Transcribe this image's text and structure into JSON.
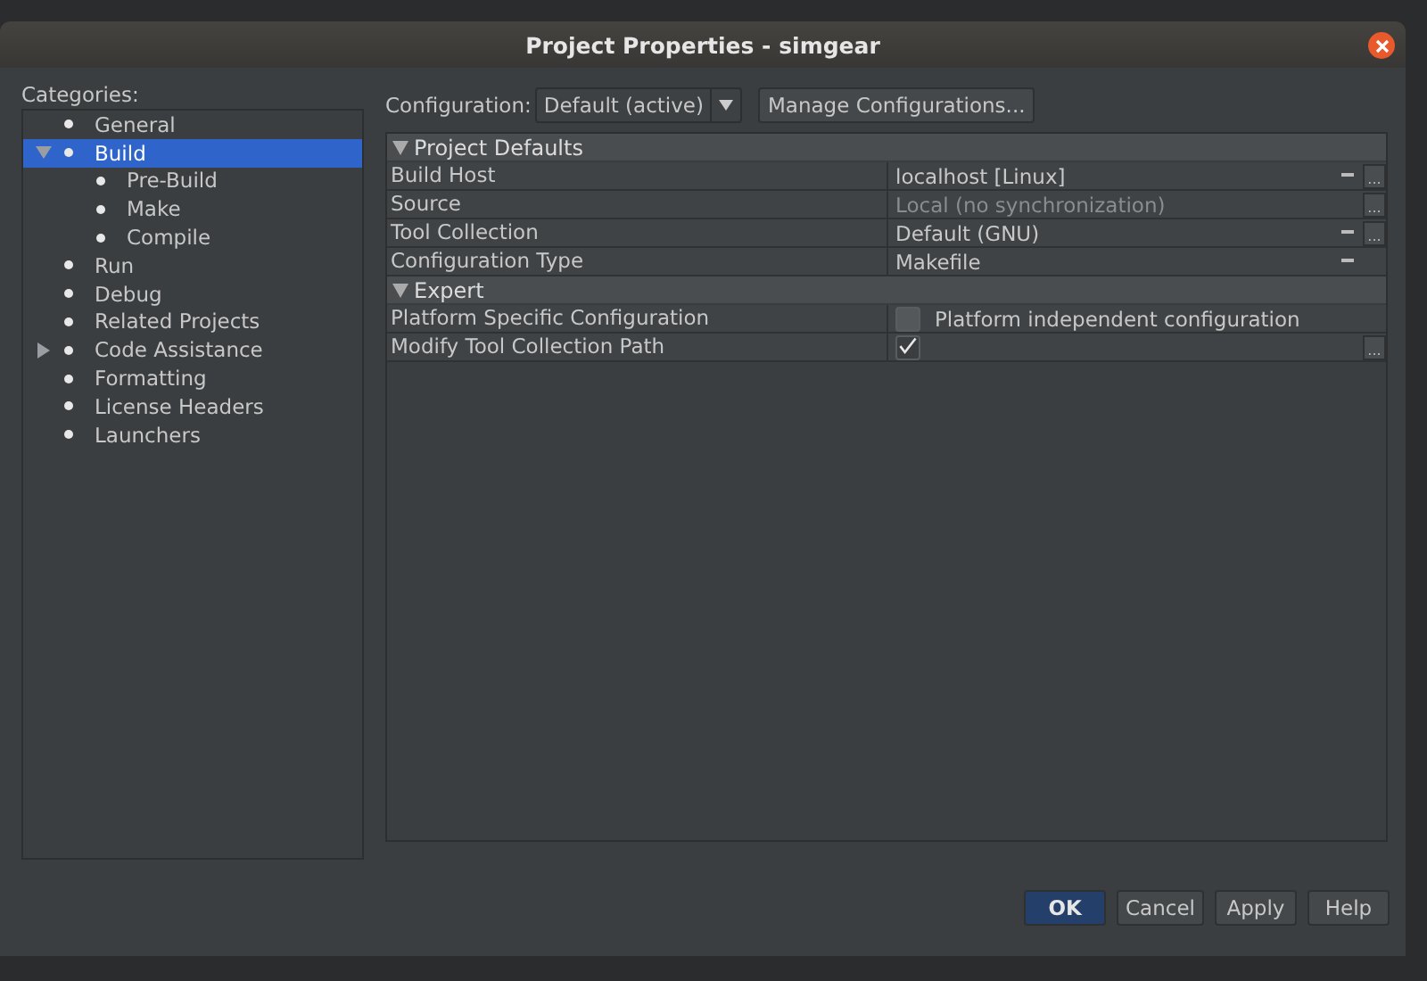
{
  "window": {
    "title": "Project Properties - simgear"
  },
  "categories": {
    "label": "Categories:",
    "items": [
      {
        "label": "General",
        "selected": false
      },
      {
        "label": "Build",
        "selected": true,
        "expanded": true,
        "children": [
          {
            "label": "Pre-Build",
            "selected": false
          },
          {
            "label": "Make",
            "selected": false
          },
          {
            "label": "Compile",
            "selected": false
          }
        ]
      },
      {
        "label": "Run",
        "selected": false
      },
      {
        "label": "Debug",
        "selected": false
      },
      {
        "label": "Related Projects",
        "selected": false
      },
      {
        "label": "Code Assistance",
        "selected": false,
        "expanded": false
      },
      {
        "label": "Formatting",
        "selected": false
      },
      {
        "label": "License Headers",
        "selected": false
      },
      {
        "label": "Launchers",
        "selected": false
      }
    ]
  },
  "configuration": {
    "label": "Configuration:",
    "value": "Default (active)",
    "manage_button": "Manage Configurations..."
  },
  "property_sheet": [
    {
      "title": "Project Defaults",
      "expanded": true,
      "rows": [
        {
          "name": "Build Host",
          "kind": "combo",
          "value": "localhost [Linux]",
          "disabled": false,
          "dropdown": true,
          "ellipsis": "..."
        },
        {
          "name": "Source",
          "kind": "combo",
          "value": "Local (no synchronization)",
          "disabled": true,
          "dropdown": false,
          "ellipsis": "..."
        },
        {
          "name": "Tool Collection",
          "kind": "combo",
          "value": "Default (GNU)",
          "disabled": false,
          "dropdown": true,
          "ellipsis": "..."
        },
        {
          "name": "Configuration Type",
          "kind": "combo",
          "value": "Makefile",
          "disabled": false,
          "dropdown": true
        }
      ]
    },
    {
      "title": "Expert",
      "expanded": true,
      "rows": [
        {
          "name": "Platform Specific Configuration",
          "kind": "checkbox",
          "checked": false,
          "value": "Platform independent configuration"
        },
        {
          "name": "Modify Tool Collection Path",
          "kind": "checkbox",
          "checked": true,
          "ellipsis": "..."
        }
      ]
    }
  ],
  "buttons": [
    {
      "label": "OK",
      "default": true
    },
    {
      "label": "Cancel",
      "default": false
    },
    {
      "label": "Apply",
      "default": false
    },
    {
      "label": "Help",
      "default": false
    }
  ]
}
